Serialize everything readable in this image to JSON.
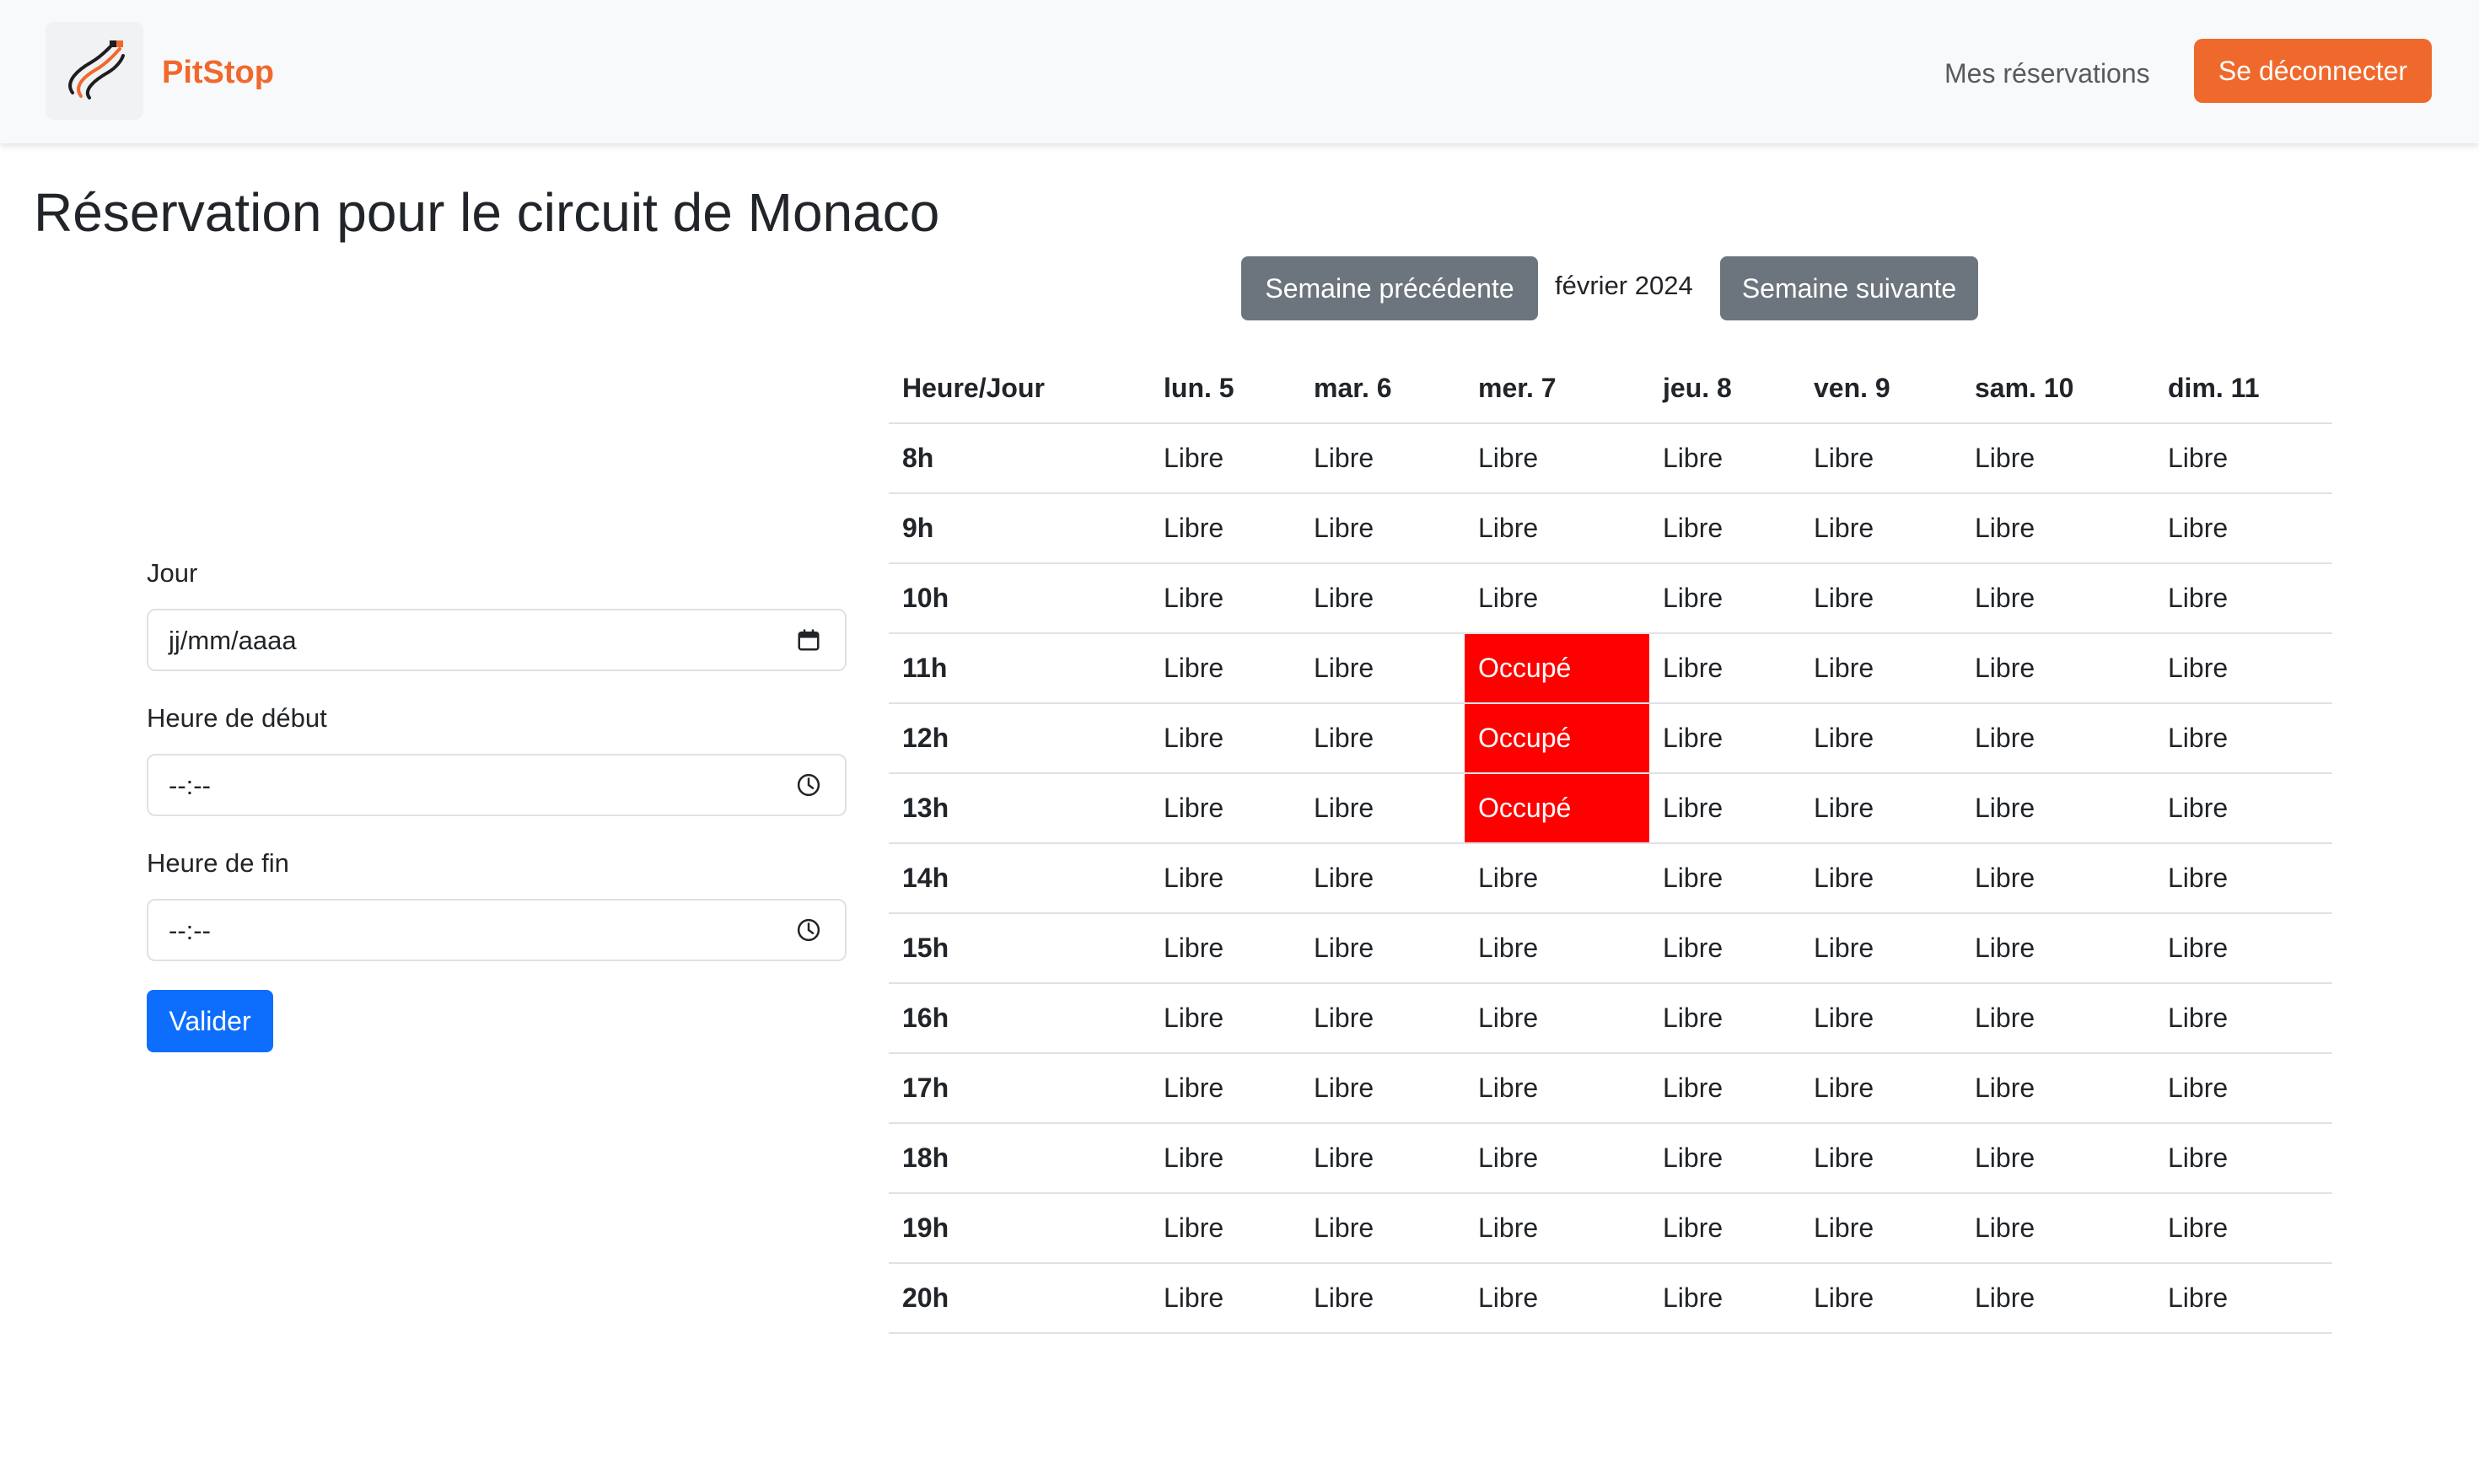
{
  "app": {
    "brand": "PitStop",
    "nav": {
      "reservations_link": "Mes réservations",
      "logout_button": "Se déconnecter"
    }
  },
  "page": {
    "title": "Réservation pour le circuit de Monaco",
    "week_nav": {
      "prev_label": "Semaine précédente",
      "month": "février 2024",
      "next_label": "Semaine suivante"
    }
  },
  "form": {
    "day_label": "Jour",
    "day_value": "jj/mm/aaaa",
    "start_label": "Heure de début",
    "start_value": "--:--",
    "end_label": "Heure de fin",
    "end_value": "--:--",
    "submit_label": "Valider"
  },
  "schedule": {
    "corner_header": "Heure/Jour",
    "days": [
      "lun. 5",
      "mar. 6",
      "mer. 7",
      "jeu. 8",
      "ven. 9",
      "sam. 10",
      "dim. 11"
    ],
    "free_label": "Libre",
    "busy_label": "Occupé",
    "busy_color": "#ff0000",
    "rows": [
      {
        "hour": "8h",
        "cells": [
          "Libre",
          "Libre",
          "Libre",
          "Libre",
          "Libre",
          "Libre",
          "Libre"
        ]
      },
      {
        "hour": "9h",
        "cells": [
          "Libre",
          "Libre",
          "Libre",
          "Libre",
          "Libre",
          "Libre",
          "Libre"
        ]
      },
      {
        "hour": "10h",
        "cells": [
          "Libre",
          "Libre",
          "Libre",
          "Libre",
          "Libre",
          "Libre",
          "Libre"
        ]
      },
      {
        "hour": "11h",
        "cells": [
          "Libre",
          "Libre",
          "Occupé",
          "Libre",
          "Libre",
          "Libre",
          "Libre"
        ]
      },
      {
        "hour": "12h",
        "cells": [
          "Libre",
          "Libre",
          "Occupé",
          "Libre",
          "Libre",
          "Libre",
          "Libre"
        ]
      },
      {
        "hour": "13h",
        "cells": [
          "Libre",
          "Libre",
          "Occupé",
          "Libre",
          "Libre",
          "Libre",
          "Libre"
        ]
      },
      {
        "hour": "14h",
        "cells": [
          "Libre",
          "Libre",
          "Libre",
          "Libre",
          "Libre",
          "Libre",
          "Libre"
        ]
      },
      {
        "hour": "15h",
        "cells": [
          "Libre",
          "Libre",
          "Libre",
          "Libre",
          "Libre",
          "Libre",
          "Libre"
        ]
      },
      {
        "hour": "16h",
        "cells": [
          "Libre",
          "Libre",
          "Libre",
          "Libre",
          "Libre",
          "Libre",
          "Libre"
        ]
      },
      {
        "hour": "17h",
        "cells": [
          "Libre",
          "Libre",
          "Libre",
          "Libre",
          "Libre",
          "Libre",
          "Libre"
        ]
      },
      {
        "hour": "18h",
        "cells": [
          "Libre",
          "Libre",
          "Libre",
          "Libre",
          "Libre",
          "Libre",
          "Libre"
        ]
      },
      {
        "hour": "19h",
        "cells": [
          "Libre",
          "Libre",
          "Libre",
          "Libre",
          "Libre",
          "Libre",
          "Libre"
        ]
      },
      {
        "hour": "20h",
        "cells": [
          "Libre",
          "Libre",
          "Libre",
          "Libre",
          "Libre",
          "Libre",
          "Libre"
        ]
      }
    ]
  },
  "colors": {
    "brand": "#f0692c",
    "primary": "#0d6efd",
    "secondary": "#6c757d"
  },
  "icons": {
    "logo": "racing-track-logo-icon",
    "date": "calendar-icon",
    "time": "clock-icon"
  }
}
